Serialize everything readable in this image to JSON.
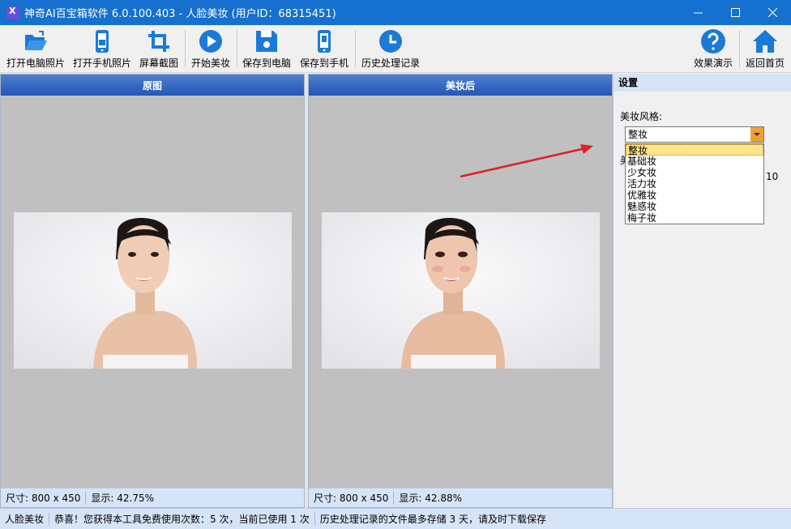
{
  "window": {
    "title": "神奇AI百宝箱软件 6.0.100.403 - 人脸美妆 (用户ID：68315451)"
  },
  "toolbar": {
    "open_pc_photo": "打开电脑照片",
    "open_phone_photo": "打开手机照片",
    "screenshot": "屏幕截图",
    "start_makeup": "开始美妆",
    "save_to_pc": "保存到电脑",
    "save_to_phone": "保存到手机",
    "history": "历史处理记录",
    "demo": "效果演示",
    "home": "返回首页"
  },
  "left_panel": {
    "title": "原图",
    "size_text": "尺寸: 800 x 450",
    "zoom_text": "显示: 42.75%"
  },
  "right_panel": {
    "title": "美妆后",
    "size_text": "尺寸: 800 x 450",
    "zoom_text": "显示: 42.88%"
  },
  "settings": {
    "title": "设置",
    "style_label": "美妆风格:",
    "selected_style": "整妆",
    "options": [
      "整妆",
      "基础妆",
      "少女妆",
      "活力妆",
      "优雅妆",
      "魅惑妆",
      "梅子妆"
    ],
    "obscured_label_fragment": "美",
    "obscured_value_fragment": "10"
  },
  "statusbar": {
    "module": "人脸美妆",
    "usage": "恭喜！您获得本工具免费使用次数：5 次，当前已使用 1 次",
    "history_note": "历史处理记录的文件最多存储 3 天，请及时下载保存"
  },
  "colors": {
    "titlebar": "#1570cf",
    "icon_blue": "#1a7ad8",
    "panel_header": "#2456b4",
    "arrow": "#e02020"
  }
}
